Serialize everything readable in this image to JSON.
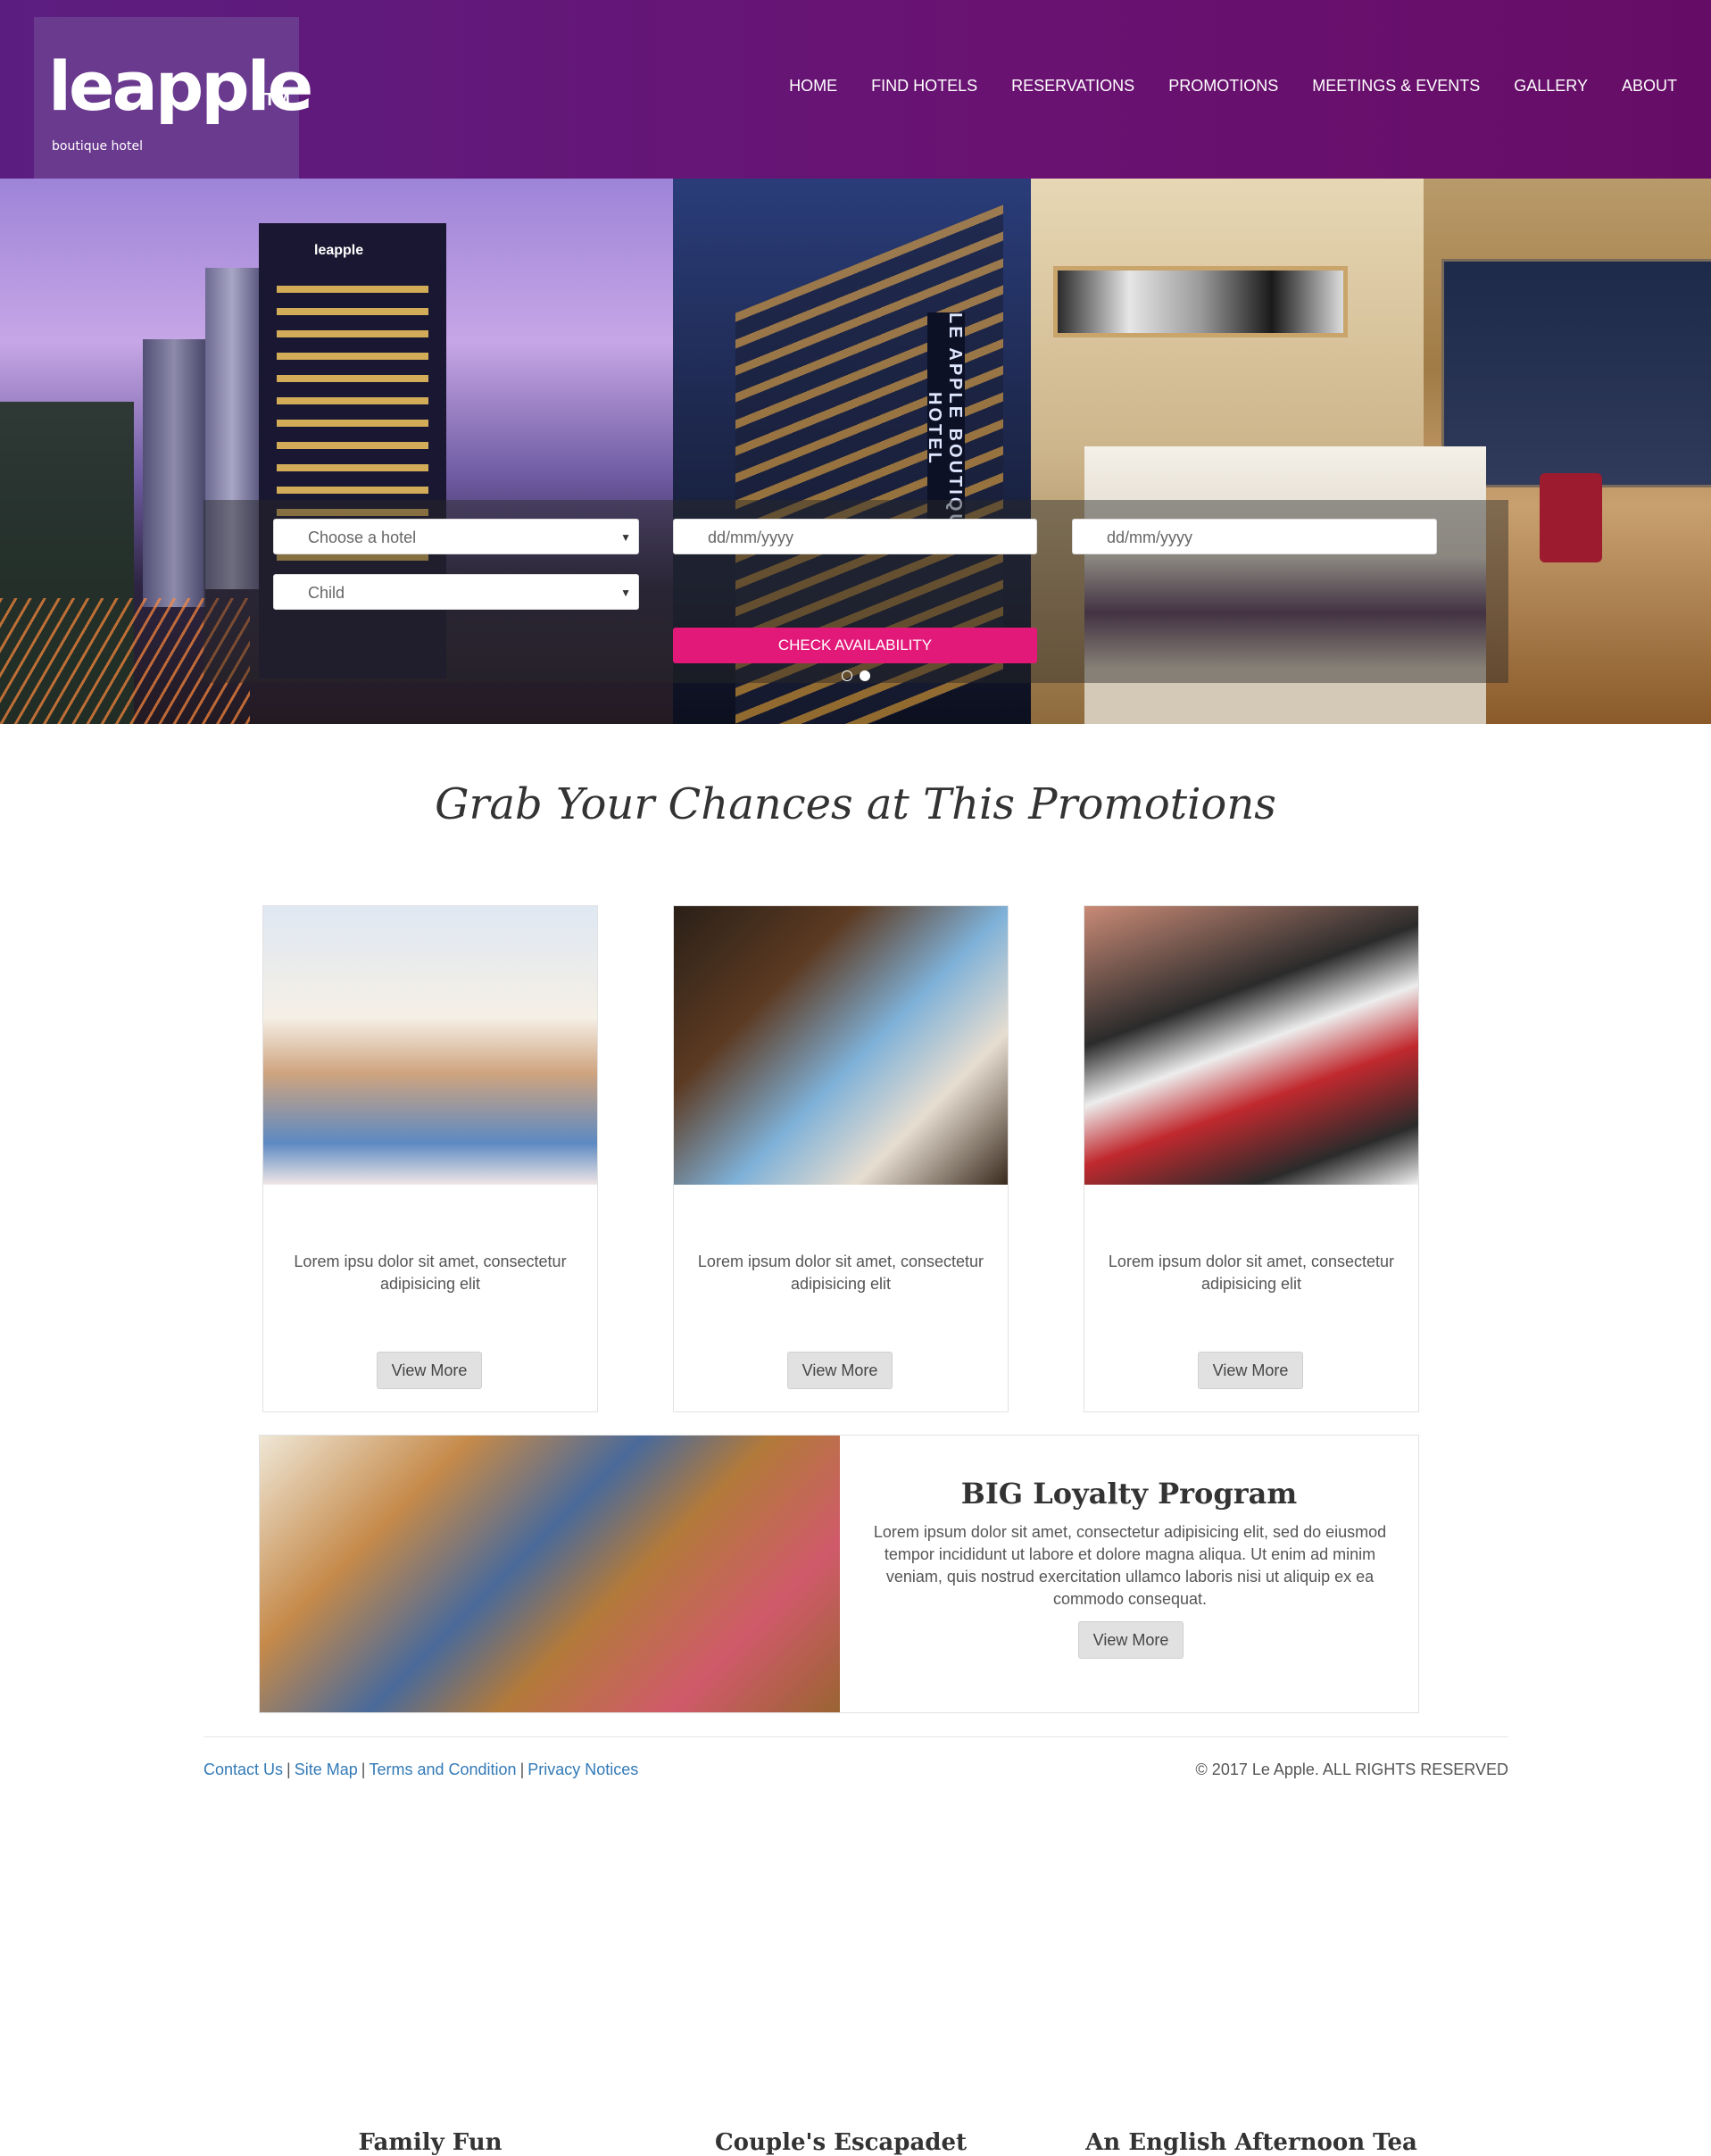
{
  "brand": {
    "logo": "leapple",
    "tm": "TM",
    "tagline": "boutique hotel"
  },
  "nav": [
    "HOME",
    "FIND HOTELS",
    "RESERVATIONS",
    "PROMOTIONS",
    "MEETINGS & EVENTS",
    "GALLERY",
    "ABOUT"
  ],
  "hero": {
    "building_sign": "leapple",
    "tower_sign": "LE APPLE BOUTIQUE HOTEL"
  },
  "booking": {
    "hotel_select": "Choose a hotel",
    "child_select": "Child",
    "checkin_placeholder": "dd/mm/yyyy",
    "checkout_placeholder": "dd/mm/yyyy",
    "button": "CHECK AVAILABILITY",
    "slides": 2,
    "active_slide": 2
  },
  "promotions": {
    "title": "Grab Your Chances at This Promotions",
    "cards": [
      {
        "title": "Family Fun",
        "desc": "Lorem ipsu dolor sit amet, consectetur adipisicing elit",
        "button": "View More"
      },
      {
        "title": "Couple's Escapadet",
        "desc": "Lorem ipsum dolor sit amet, consectetur adipisicing elit",
        "button": "View More"
      },
      {
        "title": "An English Afternoon Tea",
        "desc": "Lorem ipsum dolor sit amet, consectetur adipisicing elit",
        "button": "View More"
      }
    ]
  },
  "loyalty": {
    "title": "BIG Loyalty Program",
    "desc": "Lorem ipsum dolor sit amet, consectetur adipisicing elit, sed do eiusmod tempor incididunt ut labore et dolore magna aliqua. Ut enim ad minim veniam, quis nostrud exercitation ullamco laboris nisi ut aliquip ex ea commodo consequat.",
    "button": "View More"
  },
  "footer": {
    "links": [
      "Contact Us",
      "Site Map",
      "Terms and Condition",
      "Privacy Notices"
    ],
    "separator": "|",
    "copyright": "© 2017 Le Apple. ALL RIGHTS RESERVED"
  },
  "colors": {
    "header": "#5b1e80",
    "accent": "#e3197a",
    "link": "#337ab7"
  }
}
